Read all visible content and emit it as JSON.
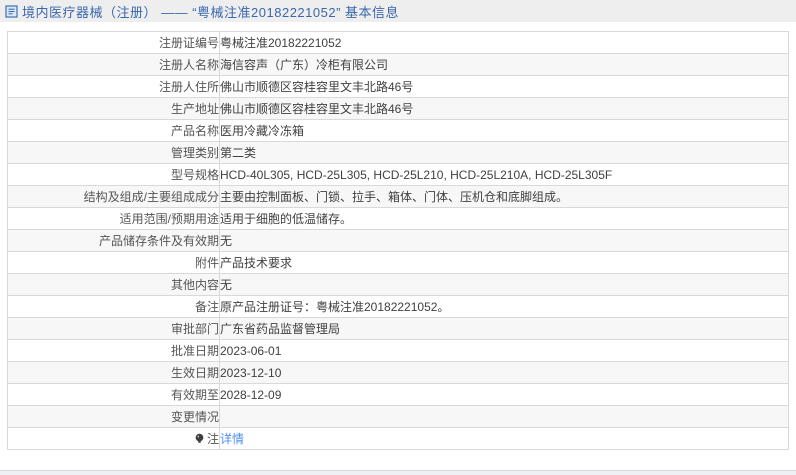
{
  "header": {
    "title": "境内医疗器械（注册） —— “粤械注准20182221052” 基本信息",
    "icon": "document-icon",
    "title_color": "#3a67ad"
  },
  "table": {
    "rows": [
      {
        "label": "注册证编号",
        "value": "粤械注准20182221052"
      },
      {
        "label": "注册人名称",
        "value": "海信容声（广东）冷柜有限公司"
      },
      {
        "label": "注册人住所",
        "value": "佛山市顺德区容桂容里文丰北路46号"
      },
      {
        "label": "生产地址",
        "value": "佛山市顺德区容桂容里文丰北路46号"
      },
      {
        "label": "产品名称",
        "value": "医用冷藏冷冻箱"
      },
      {
        "label": "管理类别",
        "value": "第二类"
      },
      {
        "label": "型号规格",
        "value": "HCD-40L305, HCD-25L305, HCD-25L210, HCD-25L210A, HCD-25L305F"
      },
      {
        "label": "结构及组成/主要组成成分",
        "value": "主要由控制面板、门锁、拉手、箱体、门体、压机仓和底脚组成。"
      },
      {
        "label": "适用范围/预期用途",
        "value": "适用于细胞的低温储存。"
      },
      {
        "label": "产品储存条件及有效期",
        "value": "无"
      },
      {
        "label": "附件",
        "value": "产品技术要求"
      },
      {
        "label": "其他内容",
        "value": "无"
      },
      {
        "label": "备注",
        "value": "原产品注册证号：粤械注准20182221052。"
      },
      {
        "label": "审批部门",
        "value": "广东省药品监督管理局"
      },
      {
        "label": "批准日期",
        "value": "2023-06-01"
      },
      {
        "label": "生效日期",
        "value": "2023-12-10"
      },
      {
        "label": "有效期至",
        "value": "2028-12-09"
      },
      {
        "label": "变更情况",
        "value": ""
      },
      {
        "label": "注",
        "value": "详情",
        "value_is_link": true,
        "label_icon": "note-icon"
      }
    ]
  },
  "colors": {
    "title_bar_bg": "#eeeeee",
    "title_text": "#3a67ad",
    "link": "#508df2",
    "row_alt_bg": "#f7f7f7",
    "border": "#d9d9d9",
    "label_text": "#555555",
    "value_text": "#404040"
  }
}
